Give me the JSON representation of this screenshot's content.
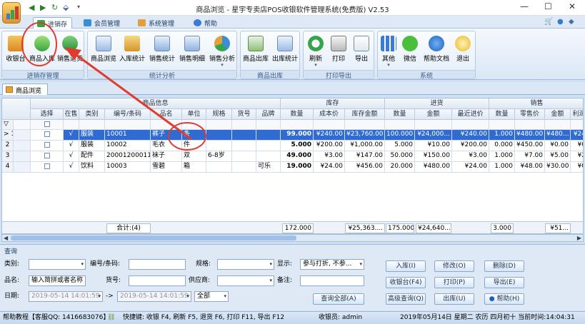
{
  "window": {
    "title": "商品浏览 - 星宇专卖店POS收银软件管理系统(免费版) V2.53"
  },
  "menu_tabs": [
    {
      "label": "进销存",
      "active": true
    },
    {
      "label": "会员管理"
    },
    {
      "label": "系统管理"
    },
    {
      "label": "帮助"
    }
  ],
  "ribbon": {
    "groups": [
      {
        "label": "进销存管理",
        "buttons": [
          {
            "label": "收银台"
          },
          {
            "label": "商品入库"
          },
          {
            "label": "销售退货"
          }
        ]
      },
      {
        "label": "统计分析",
        "buttons": [
          {
            "label": "商品浏览"
          },
          {
            "label": "入库统计"
          },
          {
            "label": "销售统计"
          },
          {
            "label": "销售明细"
          },
          {
            "label": "销售分析"
          }
        ]
      },
      {
        "label": "商品出库",
        "buttons": [
          {
            "label": "商品出库"
          },
          {
            "label": "出库统计"
          }
        ]
      },
      {
        "label": "打印导出",
        "buttons": [
          {
            "label": "刷新"
          },
          {
            "label": "打印"
          },
          {
            "label": "导出"
          }
        ]
      },
      {
        "label": "系统",
        "buttons": [
          {
            "label": "其他"
          },
          {
            "label": "微信"
          },
          {
            "label": "帮助文档"
          },
          {
            "label": "退出"
          }
        ]
      }
    ]
  },
  "doc_tab": {
    "label": "商品浏览"
  },
  "grid": {
    "group_headers": {
      "info": "商品信息",
      "stock": "库存",
      "purchase": "进货",
      "sales": "销售"
    },
    "columns": [
      "选择",
      "在售",
      "类别",
      "编号/条码",
      "品名",
      "单位",
      "规格",
      "货号",
      "品牌",
      "数量",
      "成本价",
      "库存金额",
      "数量",
      "金额",
      "最近进价",
      "数量",
      "零售价",
      "金额",
      "利润"
    ],
    "rows": [
      {
        "no": "1",
        "selected": true,
        "on_sale": "√",
        "category": "服装",
        "code": "10001",
        "name": "裤子",
        "unit": "条",
        "spec": "",
        "item_no": "",
        "brand": "",
        "stock_qty": "99.000",
        "cost": "¥240.00",
        "stock_amount": "¥23,760.00",
        "in_qty": "100.000",
        "in_amount": "¥24,000...",
        "last_price": "¥240.00",
        "sale_qty": "1.000",
        "retail": "¥480.00",
        "sale_amount": "¥480...",
        "profit": "¥24"
      },
      {
        "no": "2",
        "selected": false,
        "on_sale": "√",
        "category": "服装",
        "code": "10002",
        "name": "毛衣",
        "unit": "件",
        "spec": "",
        "item_no": "",
        "brand": "",
        "stock_qty": "5.000",
        "cost": "¥200.00",
        "stock_amount": "¥1,000.00",
        "in_qty": "5.000",
        "in_amount": "¥10.00",
        "last_price": "¥200.00",
        "sale_qty": "0.000",
        "retail": "¥450.00",
        "sale_amount": "¥0.00",
        "profit": "¥0"
      },
      {
        "no": "3",
        "selected": false,
        "on_sale": "√",
        "category": "配件",
        "code": "20001200011",
        "name": "袜子",
        "unit": "双",
        "spec": "6-8岁",
        "item_no": "",
        "brand": "",
        "stock_qty": "49.000",
        "cost": "¥3.00",
        "stock_amount": "¥147.00",
        "in_qty": "50.000",
        "in_amount": "¥150.00",
        "last_price": "¥3.00",
        "sale_qty": "1.000",
        "retail": "¥7.00",
        "sale_amount": "¥5.00",
        "profit": "¥2"
      },
      {
        "no": "4",
        "selected": false,
        "on_sale": "√",
        "category": "饮料",
        "code": "10003",
        "name": "雪碧",
        "unit": "箱",
        "spec": "",
        "item_no": "",
        "brand": "可乐",
        "stock_qty": "19.000",
        "cost": "¥24.00",
        "stock_amount": "¥456.00",
        "in_qty": "20.000",
        "in_amount": "¥480.00",
        "last_price": "¥24.00",
        "sale_qty": "1.000",
        "retail": "¥48.00",
        "sale_amount": "¥30.00",
        "profit": "¥0"
      }
    ],
    "totals": {
      "label": "合计:(4)",
      "stock_qty": "172.000",
      "stock_amount": "¥25,363....",
      "in_qty": "175.000",
      "in_amount": "¥24,640...",
      "sale_qty": "3.000",
      "sale_amount": "¥51..."
    }
  },
  "query": {
    "title": "查询",
    "fields": {
      "category": {
        "label": "类别:"
      },
      "code": {
        "label": "编号/条码:"
      },
      "spec": {
        "label": "规格:"
      },
      "display": {
        "label": "显示:",
        "value": "参与打折, 不参..."
      },
      "name": {
        "label": "品名:",
        "value": "输入简拼或者名称"
      },
      "item_no": {
        "label": "货号:"
      },
      "supplier": {
        "label": "供应商:"
      },
      "remark": {
        "label": "备注:"
      },
      "date": {
        "label": "日期:",
        "from": "2019-05-14 14:01:59",
        "arrow": "->",
        "to": "2019-05-14 14:01:59",
        "scope": "全部"
      }
    },
    "buttons": {
      "query_all": "查询全部(A)",
      "stock_in": "入库(I)",
      "edit": "修改(O)",
      "delete": "删除(D)",
      "cashier": "收银台(F4)",
      "print": "打印(P)",
      "export": "导出(E)",
      "advanced": "高级查询(Q)",
      "stock_out": "出库(U)",
      "help": "帮助(H)"
    }
  },
  "status": {
    "help": "帮助教程【客服QQ: 1416683076】",
    "shortcuts": "快捷键: 收银 F4, 刷新 F5, 退货 F6, 打印 F11, 导出 F12",
    "cashier": "收银员: admin",
    "datetime": "2019年05月14日 星期二 农历 四月初十 当前时间:14:04:31"
  },
  "colors": {
    "selected_row": "#2f6bd1",
    "annotation": "#e23b2e",
    "ribbon_bg": "#dbe7f5"
  }
}
